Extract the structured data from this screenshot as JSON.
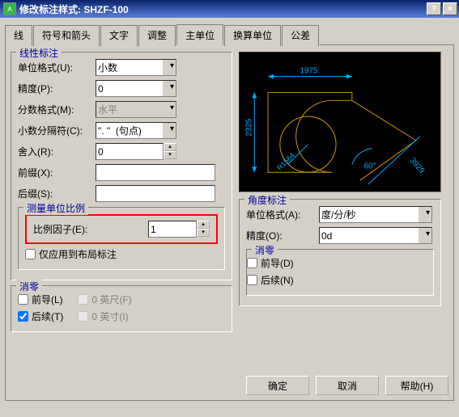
{
  "window": {
    "title": "修改标注样式: SHZF-100",
    "help_btn": "?",
    "close_btn": "×"
  },
  "tabs": {
    "t0": "线",
    "t1": "符号和箭头",
    "t2": "文字",
    "t3": "调整",
    "t4": "主单位",
    "t5": "换算单位",
    "t6": "公差"
  },
  "linear": {
    "legend": "线性标注",
    "unit_format_label": "单位格式(U):",
    "unit_format_value": "小数",
    "precision_label": "精度(P):",
    "precision_value": "0",
    "fraction_format_label": "分数格式(M):",
    "fraction_format_value": "水平",
    "decimal_sep_label": "小数分隔符(C):",
    "decimal_sep_value": "\". \"  (句点)",
    "round_label": "舍入(R):",
    "round_value": "0",
    "prefix_label": "前缀(X):",
    "prefix_value": "",
    "suffix_label": "后缀(S):",
    "suffix_value": ""
  },
  "scale": {
    "legend": "测量单位比例",
    "factor_label": "比例因子(E):",
    "factor_value": "1",
    "apply_layout_label": "仅应用到布局标注"
  },
  "zero": {
    "legend": "消零",
    "leading_label": "前导(L)",
    "trailing_label": "后续(T)",
    "feet_label": "0 英尺(F)",
    "inches_label": "0 英寸(I)"
  },
  "preview": {
    "dim1": "1975",
    "dim2": "2325",
    "dim3": "3929",
    "angle": "60°",
    "radius": "R1564"
  },
  "angle": {
    "legend": "角度标注",
    "format_label": "单位格式(A):",
    "format_value": "度/分/秒",
    "precision_label": "精度(O):",
    "precision_value": "0d",
    "zero_legend": "消零",
    "zero_leading": "前导(D)",
    "zero_trailing": "后续(N)"
  },
  "buttons": {
    "ok": "确定",
    "cancel": "取消",
    "help": "帮助(H)"
  }
}
